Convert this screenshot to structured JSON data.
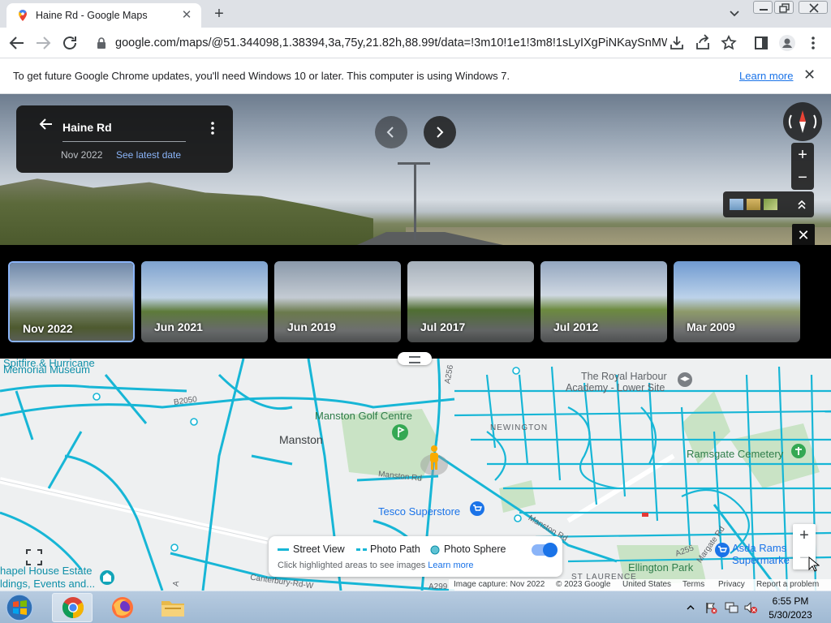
{
  "browser": {
    "tab_title": "Haine Rd - Google Maps",
    "url": "google.com/maps/@51.344098,1.38394,3a,75y,21.82h,88.99t/data=!3m10!1e1!3m8!1sLyIXgPiNKaySnMWn9..."
  },
  "infobar": {
    "message": "To get future Google Chrome updates, you'll need Windows 10 or later. This computer is using Windows 7.",
    "learn_more": "Learn more"
  },
  "streetview": {
    "street": "Haine Rd",
    "date": "Nov 2022",
    "see_latest": "See latest date"
  },
  "timeline": [
    {
      "label": "Nov 2022",
      "selected": true
    },
    {
      "label": "Jun 2021",
      "selected": false
    },
    {
      "label": "Jun 2019",
      "selected": false
    },
    {
      "label": "Jul 2017",
      "selected": false
    },
    {
      "label": "Jul 2012",
      "selected": false
    },
    {
      "label": "Mar 2009",
      "selected": false
    }
  ],
  "map": {
    "labels": {
      "spitfire": "Spitfire & Hurricane",
      "memorial": "Memorial Museum",
      "b2050": "B2050",
      "manston_golf": "Manston Golf Centre",
      "manston": "Manston",
      "newington": "NEWINGTON",
      "royal_harbour1": "The Royal Harbour",
      "royal_harbour2": "Academy - Lower Site",
      "ramsgate_cemetery": "Ramsgate Cemetery",
      "manston_rd1": "Manston Rd",
      "manston_rd2": "Manston Rd",
      "tesco": "Tesco Superstore",
      "margate_rd": "Margate Rd",
      "a255": "A255",
      "a256": "A256",
      "asda1": "Asda Rams",
      "asda2": "Supermarke",
      "ellington": "Ellington Park",
      "st_laurence": "ST LAURENCE",
      "chapel1": "hapel House Estate",
      "chapel2": "ldings, Events and...",
      "canterbury_rd": "Canterbury-Rd-W",
      "a299": "A299",
      "a_left": "A"
    },
    "legend": {
      "street_view": "Street View",
      "photo_path": "Photo Path",
      "photo_sphere": "Photo Sphere",
      "hint": "Click highlighted areas to see images",
      "learn_more": "Learn more",
      "toggle_on": true
    },
    "attribution": {
      "capture": "Image capture: Nov 2022",
      "copyright": "© 2023 Google",
      "country": "United States",
      "terms": "Terms",
      "privacy": "Privacy",
      "report": "Report a problem"
    }
  },
  "taskbar": {
    "time": "6:55 PM",
    "date": "5/30/2023"
  },
  "colors": {
    "road_highlight": "#17b6d6",
    "link_blue": "#1a73e8",
    "map_green": "#c9e3c5"
  }
}
